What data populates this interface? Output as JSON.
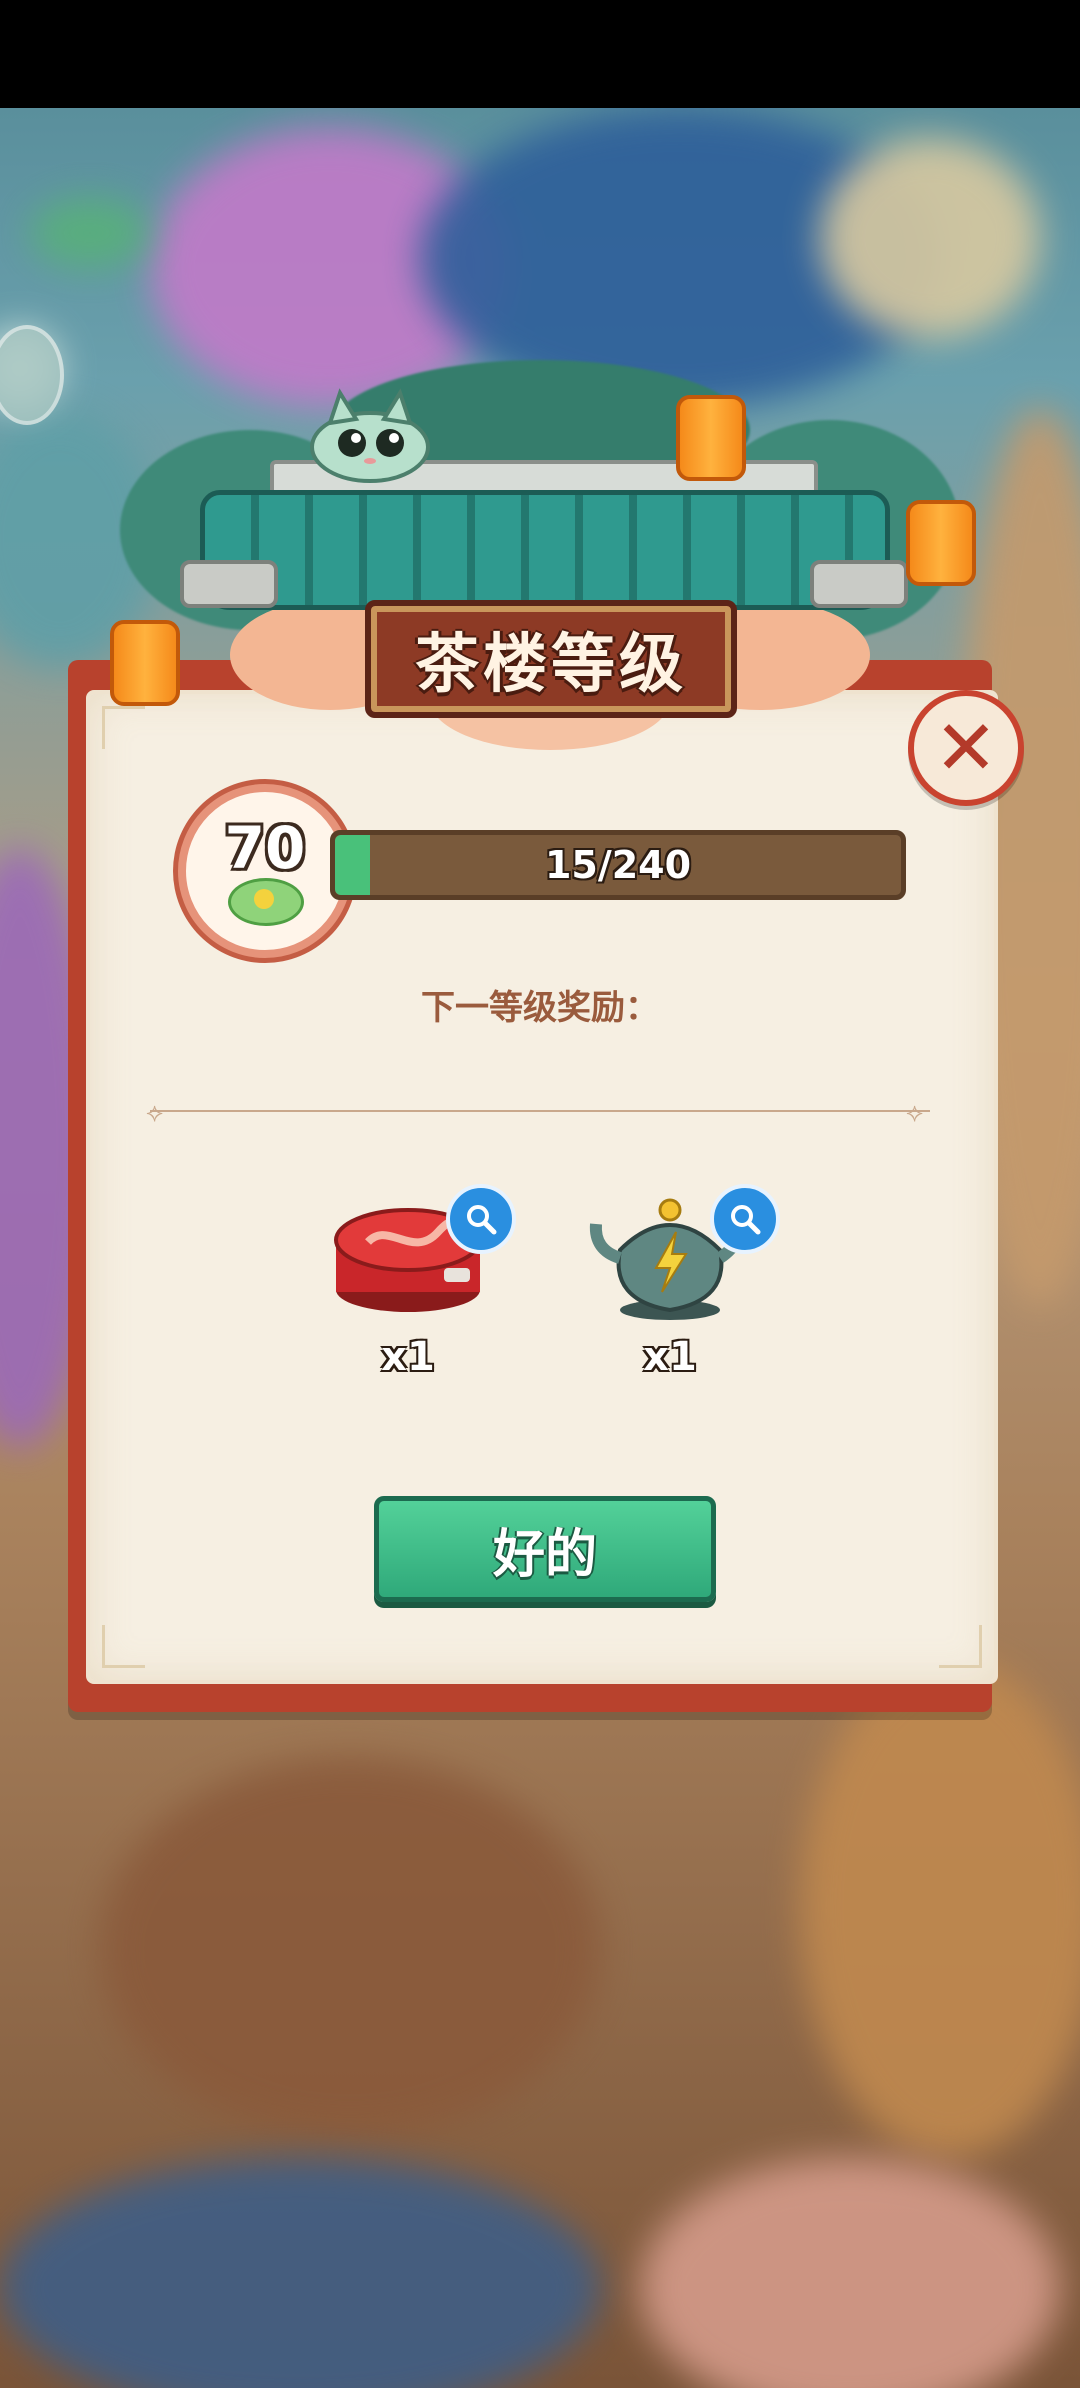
{
  "dialog": {
    "title": "茶楼等级",
    "close_symbol": "✕",
    "level": "70",
    "progress": {
      "current": 15,
      "max": 240,
      "label": "15/240"
    },
    "subtitle": "下一等级奖励：",
    "rewards": [
      {
        "name": "red-tin-box",
        "quantity": "x1",
        "icon": "red-box-icon"
      },
      {
        "name": "lightning-teapot",
        "quantity": "x1",
        "icon": "teapot-icon"
      }
    ],
    "ok_button_label": "好的"
  },
  "colors": {
    "panel": "#f6efe2",
    "frame": "#b8422d",
    "progress_fill": "#49c17a",
    "button": "#3fbd86",
    "title_plaque": "#8d3a25"
  }
}
